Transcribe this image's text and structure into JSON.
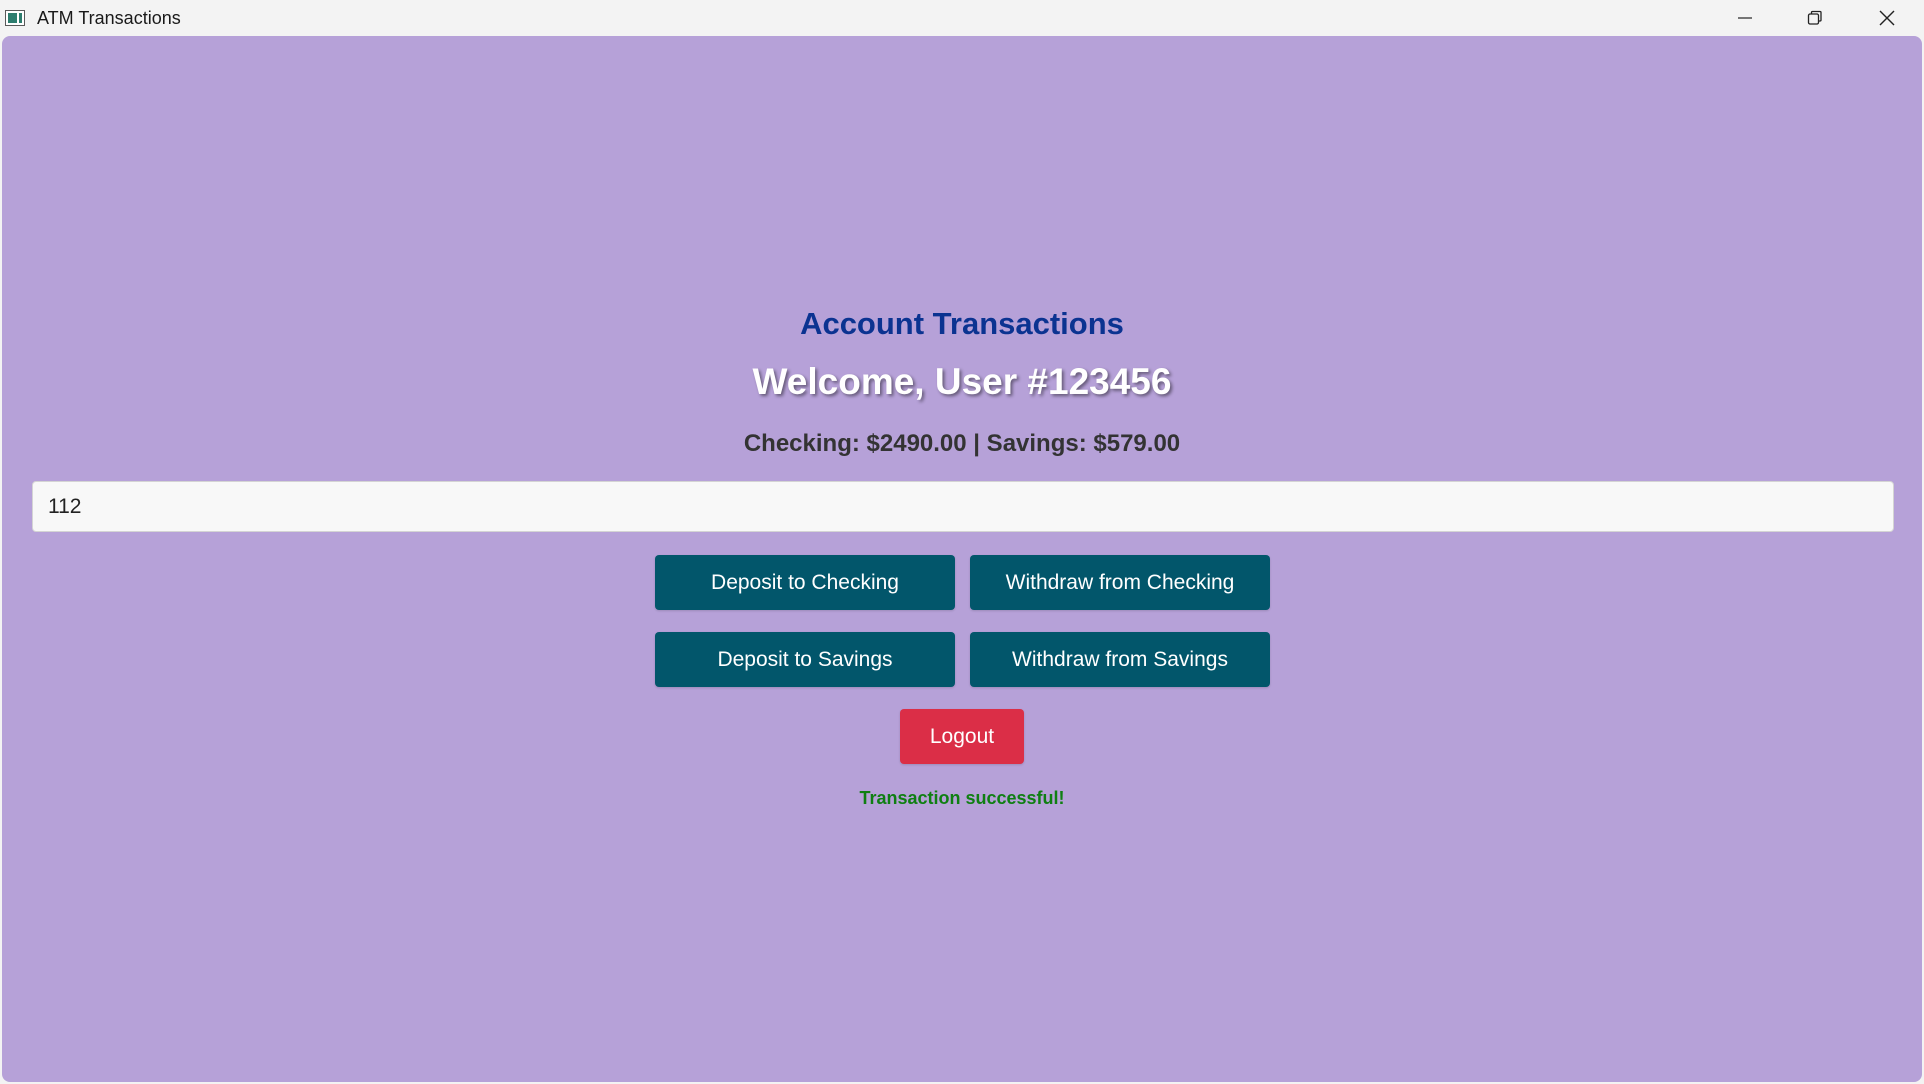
{
  "window": {
    "title": "ATM Transactions",
    "icon": "app-window-icon",
    "controls": {
      "minimize_icon": "minimize-icon",
      "maximize_icon": "restore-icon",
      "close_icon": "close-icon"
    }
  },
  "main": {
    "heading": "Account Transactions",
    "welcome": "Welcome, User #123456",
    "balances": "Checking: $2490.00 | Savings: $579.00",
    "amount_input": {
      "value": "112",
      "placeholder": ""
    },
    "buttons": {
      "deposit_checking": "Deposit to Checking",
      "withdraw_checking": "Withdraw from Checking",
      "deposit_savings": "Deposit to Savings",
      "withdraw_savings": "Withdraw from Savings",
      "logout": "Logout"
    },
    "status_message": "Transaction successful!"
  },
  "colors": {
    "background": "#b6a1d8",
    "heading": "#0b3391",
    "primary_button": "#02566b",
    "logout_button": "#db2e47",
    "success_text": "#0f7f12"
  }
}
